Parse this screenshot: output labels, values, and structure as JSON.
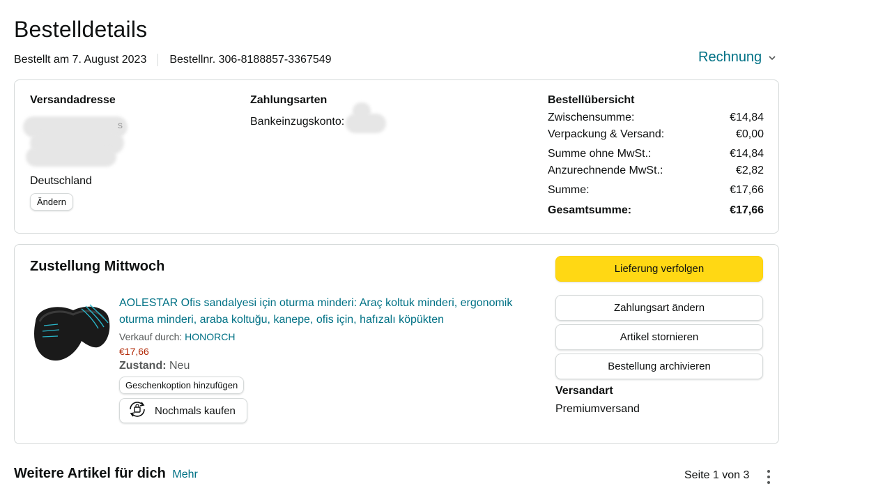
{
  "page": {
    "title": "Bestelldetails",
    "ordered_on": "Bestellt am 7. August 2023",
    "order_number": "Bestellnr. 306-8188857-3367549",
    "invoice_label": "Rechnung",
    "invoice_icon": "chevron-down-icon"
  },
  "summary_card": {
    "address": {
      "title": "Versandadresse",
      "country": "Deutschland",
      "change_label": "Ändern"
    },
    "payment": {
      "title": "Zahlungsarten",
      "method": "Bankeinzugskonto:"
    },
    "overview": {
      "title": "Bestellübersicht",
      "rows": [
        {
          "label": "Zwischensumme:",
          "value": "€14,84"
        },
        {
          "label": "Verpackung & Versand:",
          "value": "€0,00"
        },
        {
          "label": "Summe ohne MwSt.:",
          "value": "€14,84"
        },
        {
          "label": "Anzurechnende MwSt.:",
          "value": "€2,82"
        },
        {
          "label": "Summe:",
          "value": "€17,66"
        }
      ],
      "total_label": "Gesamtsumme:",
      "total_value": "€17,66"
    }
  },
  "delivery_card": {
    "title": "Zustellung Mittwoch",
    "product": {
      "name": "AOLESTAR Ofis sandalyesi için oturma minderi: Araç koltuk minderi, ergonomik oturma minderi, araba koltuğu, kanepe, ofis için, hafızalı köpükten",
      "sold_by_label": "Verkauf durch:",
      "seller": "HONORCH",
      "price": "€17,66",
      "condition_label": "Zustand:",
      "condition_value": "Neu",
      "gift_label": "Geschenkoption hinzufügen",
      "buy_again_label": "Nochmals kaufen"
    },
    "actions": {
      "track": "Lieferung verfolgen",
      "change_payment": "Zahlungsart ändern",
      "cancel": "Artikel stornieren",
      "archive": "Bestellung archivieren"
    },
    "shipping": {
      "title": "Versandart",
      "value": "Premiumversand"
    }
  },
  "recommendations": {
    "title": "Weitere Artikel für dich",
    "more_label": "Mehr",
    "pager": "Seite 1 von 3"
  },
  "colors": {
    "link": "#007185",
    "price": "#b12704",
    "primary_button": "#ffd814",
    "border": "#d5d9d9"
  }
}
